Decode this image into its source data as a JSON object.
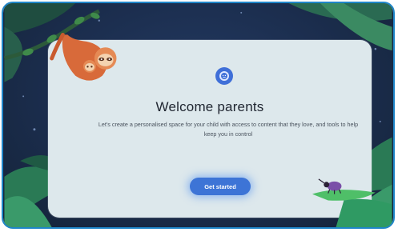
{
  "welcome": {
    "logo_icon": "kid-face-icon",
    "title": "Welcome parents",
    "description": "Let's create a personalised space for your child with access to content that they love, and tools to help keep you in control",
    "cta_label": "Get started"
  },
  "decorations": {
    "left_icon": "sloth-icon",
    "right_icon": "beetle-icon"
  },
  "colors": {
    "background": "#1b2d4d",
    "card": "#dde8ec",
    "accent": "#3d74d6",
    "border": "#1f86c9",
    "leaf": "#2f9a63"
  }
}
